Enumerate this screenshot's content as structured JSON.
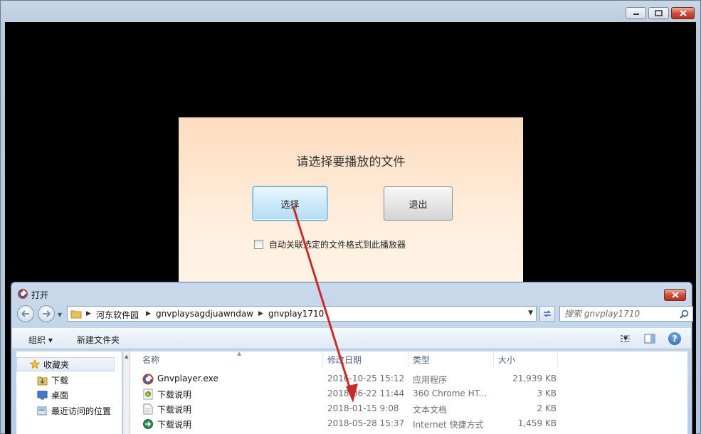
{
  "chooser": {
    "title": "请选择要播放的文件",
    "select_label": "选择",
    "exit_label": "退出",
    "associate_label": "自动关联选定的文件格式到此播放器"
  },
  "dialog": {
    "title": "打开",
    "breadcrumb": [
      "河东软件园",
      "gnvplaysagdjuawndaw",
      "gnvplay1710"
    ],
    "search_placeholder": "搜索 gnvplay1710",
    "toolbar": {
      "organize": "组织 ▾",
      "new_folder": "新建文件夹"
    },
    "nav": [
      {
        "label": "收藏夹",
        "icon": "star-icon"
      },
      {
        "label": "下载",
        "icon": "downloads-folder-icon"
      },
      {
        "label": "桌面",
        "icon": "desktop-icon"
      },
      {
        "label": "最近访问的位置",
        "icon": "recent-places-icon"
      }
    ],
    "columns": {
      "name": "名称",
      "date": "修改日期",
      "type": "类型",
      "size": "大小"
    },
    "files": [
      {
        "name": "Gnvplayer.exe",
        "date": "2016-10-25 15:12",
        "type": "应用程序",
        "size": "21,939 KB",
        "icon": "app-icon"
      },
      {
        "name": "下载说明",
        "date": "2018-06-22 11:44",
        "type": "360 Chrome HT...",
        "size": "3 KB",
        "icon": "html-file-icon"
      },
      {
        "name": "下载说明",
        "date": "2018-01-15 9:08",
        "type": "文本文档",
        "size": "2 KB",
        "icon": "text-file-icon"
      },
      {
        "name": "下载说明",
        "date": "2018-05-28 15:37",
        "type": "Internet 快捷方式",
        "size": "1,459 KB",
        "icon": "shortcut-icon"
      }
    ]
  },
  "colors": {
    "annotation_arrow": "#cc2a2a",
    "canvas": "#000000",
    "accent_button": "#b4ddf6"
  }
}
